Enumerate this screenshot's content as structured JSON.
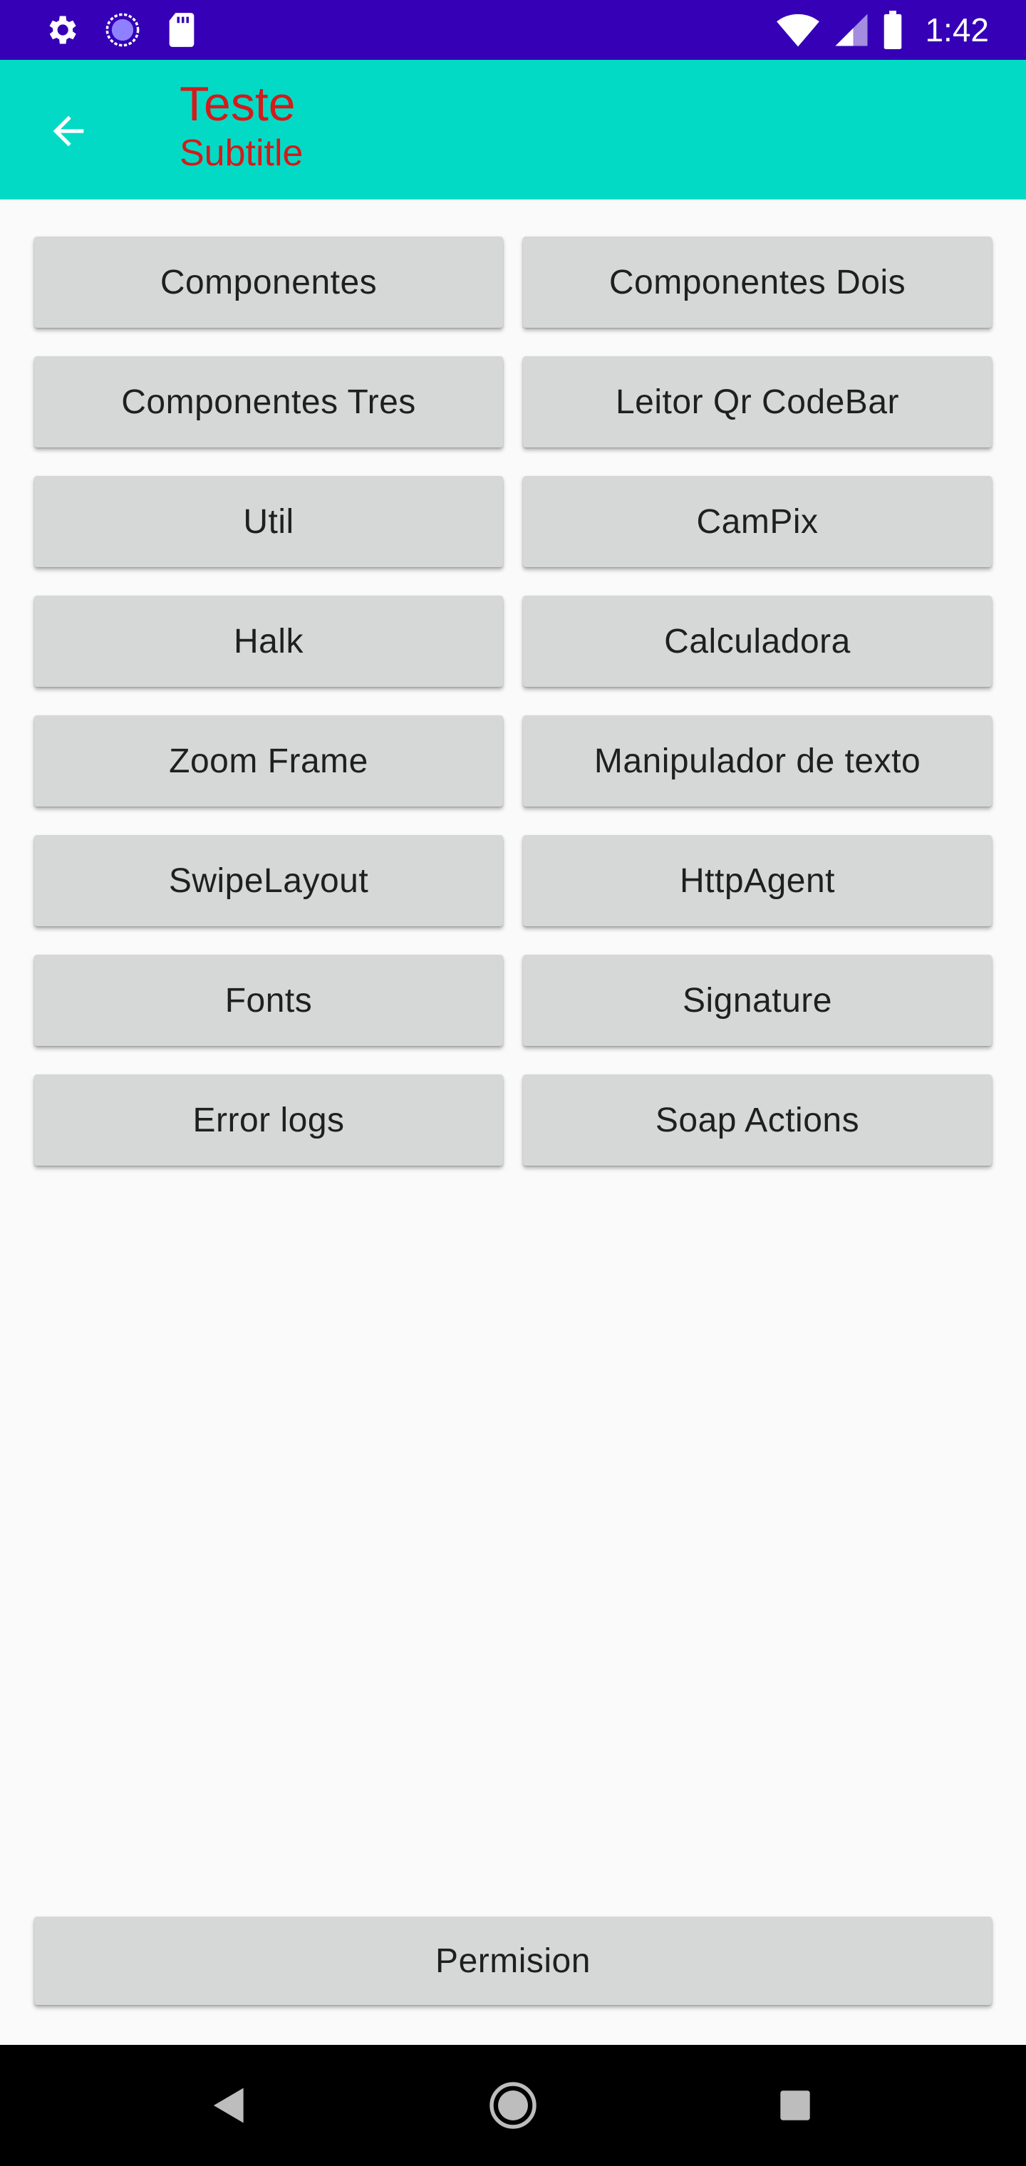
{
  "status_bar": {
    "time": "1:42",
    "left_icons": [
      "gear-icon",
      "loading-icon",
      "sd-card-icon"
    ],
    "right_icons": [
      "wifi-icon",
      "signal-icon",
      "battery-icon"
    ],
    "background": "#3500b6"
  },
  "app_bar": {
    "title": "Teste",
    "subtitle": "Subtitle",
    "background": "#03dac5",
    "title_color": "#d41a1a"
  },
  "buttons": [
    "Componentes",
    "Componentes Dois",
    "Componentes Tres",
    "Leitor Qr CodeBar",
    "Util",
    "CamPix",
    "Halk",
    "Calculadora",
    "Zoom Frame",
    "Manipulador de texto",
    "SwipeLayout",
    "HttpAgent",
    "Fonts",
    "Signature",
    "Error logs",
    "Soap Actions"
  ],
  "footer_button": "Permision",
  "nav_bar": {
    "buttons": [
      "back-triangle-icon",
      "home-circle-icon",
      "recents-square-icon"
    ]
  }
}
